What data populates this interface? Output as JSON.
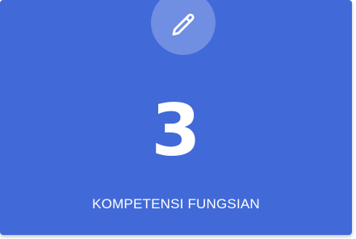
{
  "card": {
    "icon": "pencil-icon",
    "count": "3",
    "label": "KOMPETENSI FUNGSIAN",
    "colors": {
      "background": "#4169d8",
      "text": "#ffffff"
    }
  }
}
